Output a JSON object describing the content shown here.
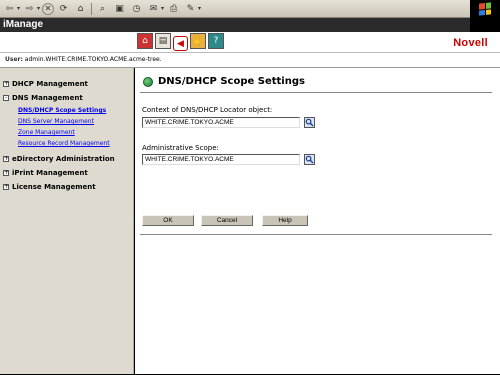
{
  "app": {
    "title": "iManage",
    "brand": "Novell",
    "brand_color": "#cc0000"
  },
  "user_bar": {
    "label": "User:",
    "value": "admin.WHITE.CRIME.TOKYO.ACME.acme-tree."
  },
  "browser_toolbar": {
    "icons": [
      "back-icon",
      "forward-icon",
      "stop-icon",
      "refresh-icon",
      "home-icon",
      "search-icon",
      "favorites-icon",
      "history-icon",
      "mail-icon",
      "print-icon",
      "edit-icon"
    ]
  },
  "header_icons": [
    "role-tasks-icon",
    "view-objects-icon",
    "home-page-icon",
    "configure-icon",
    "help-book-icon"
  ],
  "nav": {
    "groups": [
      {
        "label": "DHCP Management",
        "expander": "+"
      },
      {
        "label": "DNS Management",
        "expander": "-",
        "items": [
          {
            "label": "DNS/DHCP Scope Settings",
            "current": true
          },
          {
            "label": "DNS Server Management"
          },
          {
            "label": "Zone Management"
          },
          {
            "label": "Resource Record Management"
          }
        ]
      },
      {
        "label": "eDirectory Administration",
        "expander": "+"
      },
      {
        "label": "iPrint Management",
        "expander": "+"
      },
      {
        "label": "License Management",
        "expander": "+"
      }
    ]
  },
  "main": {
    "title": "DNS/DHCP Scope Settings",
    "locator_label": "Context of DNS/DHCP Locator object:",
    "locator_value": "WHITE.CRIME.TOKYO.ACME",
    "scope_label": "Administrative Scope:",
    "scope_value": "WHITE.CRIME.TOKYO.ACME",
    "buttons": {
      "ok": "OK",
      "cancel": "Cancel",
      "help": "Help"
    }
  }
}
